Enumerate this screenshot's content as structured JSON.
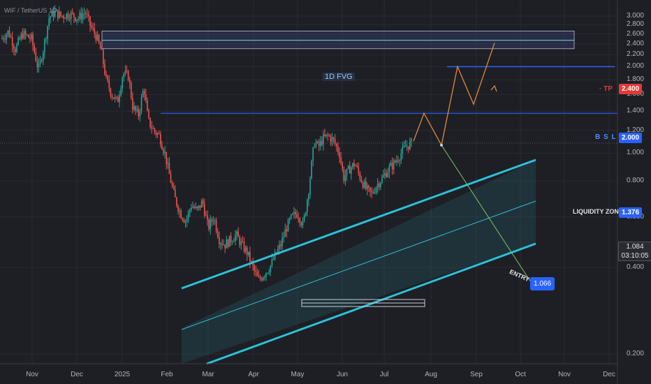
{
  "header": {
    "symbol_text": "WIF / TetherUS  1D"
  },
  "price_axis": {
    "ticks": [
      "3.000",
      "2.800",
      "2.600",
      "2.400",
      "2.200",
      "2.000",
      "1.800",
      "1.600",
      "1.400",
      "1.200",
      "1.000",
      "0.800",
      "0.600",
      "0.400",
      "0.200"
    ],
    "tick_values": [
      3.0,
      2.8,
      2.6,
      2.4,
      2.2,
      2.0,
      1.8,
      1.6,
      1.4,
      1.2,
      1.0,
      0.8,
      0.6,
      0.4,
      0.2
    ]
  },
  "time_axis": {
    "labels": [
      "Nov",
      "Dec",
      "2025",
      "Feb",
      "Mar",
      "Apr",
      "May",
      "Jun",
      "Jul",
      "Aug",
      "Sep",
      "Oct",
      "Nov",
      "Dec"
    ]
  },
  "levels": {
    "tp": {
      "label": "TP",
      "value": "2.400",
      "color": "#e53935"
    },
    "bsl": {
      "label": "B S L",
      "value": "2.000",
      "color": "#2962ff"
    },
    "liquidity": {
      "label": "LIQUIDITY ZONE",
      "value": "1.376",
      "color": "#2962ff"
    },
    "last_price": {
      "value": "1.084",
      "countdown": "03:10:05"
    }
  },
  "annotations": {
    "fvg_label": "1D FVG",
    "entry_label": "ENTRY",
    "entry_value": "1.066"
  },
  "colors": {
    "background": "#1e1f24",
    "bull": "#26a69a",
    "bear": "#ef5350",
    "channel": "#2bc0d8",
    "projection": "#e08a3c",
    "grid": "#2a2b30"
  },
  "chart_data": {
    "type": "candlestick",
    "title": "",
    "y_scale": "log",
    "ylim": [
      0.18,
      3.2
    ],
    "channel": {
      "kind": "ascending parallel channel"
    },
    "fvg_zone": {
      "label": "1D FVG",
      "from": 2.31,
      "to": 2.66
    },
    "projection_path_values": [
      1.1,
      1.376,
      1.066,
      2.0,
      1.48,
      2.42
    ],
    "close_series_approx": [
      {
        "month": "Nov",
        "value": 2.6
      },
      {
        "month": "Dec",
        "value": 3.0
      },
      {
        "month": "2025",
        "value": 2.1
      },
      {
        "month": "Feb",
        "value": 0.75
      },
      {
        "month": "Mar",
        "value": 0.5
      },
      {
        "month": "Apr",
        "value": 0.38
      },
      {
        "month": "May",
        "value": 1.15
      },
      {
        "month": "Jun",
        "value": 0.85
      },
      {
        "month": "Jul",
        "value": 1.06
      }
    ]
  }
}
